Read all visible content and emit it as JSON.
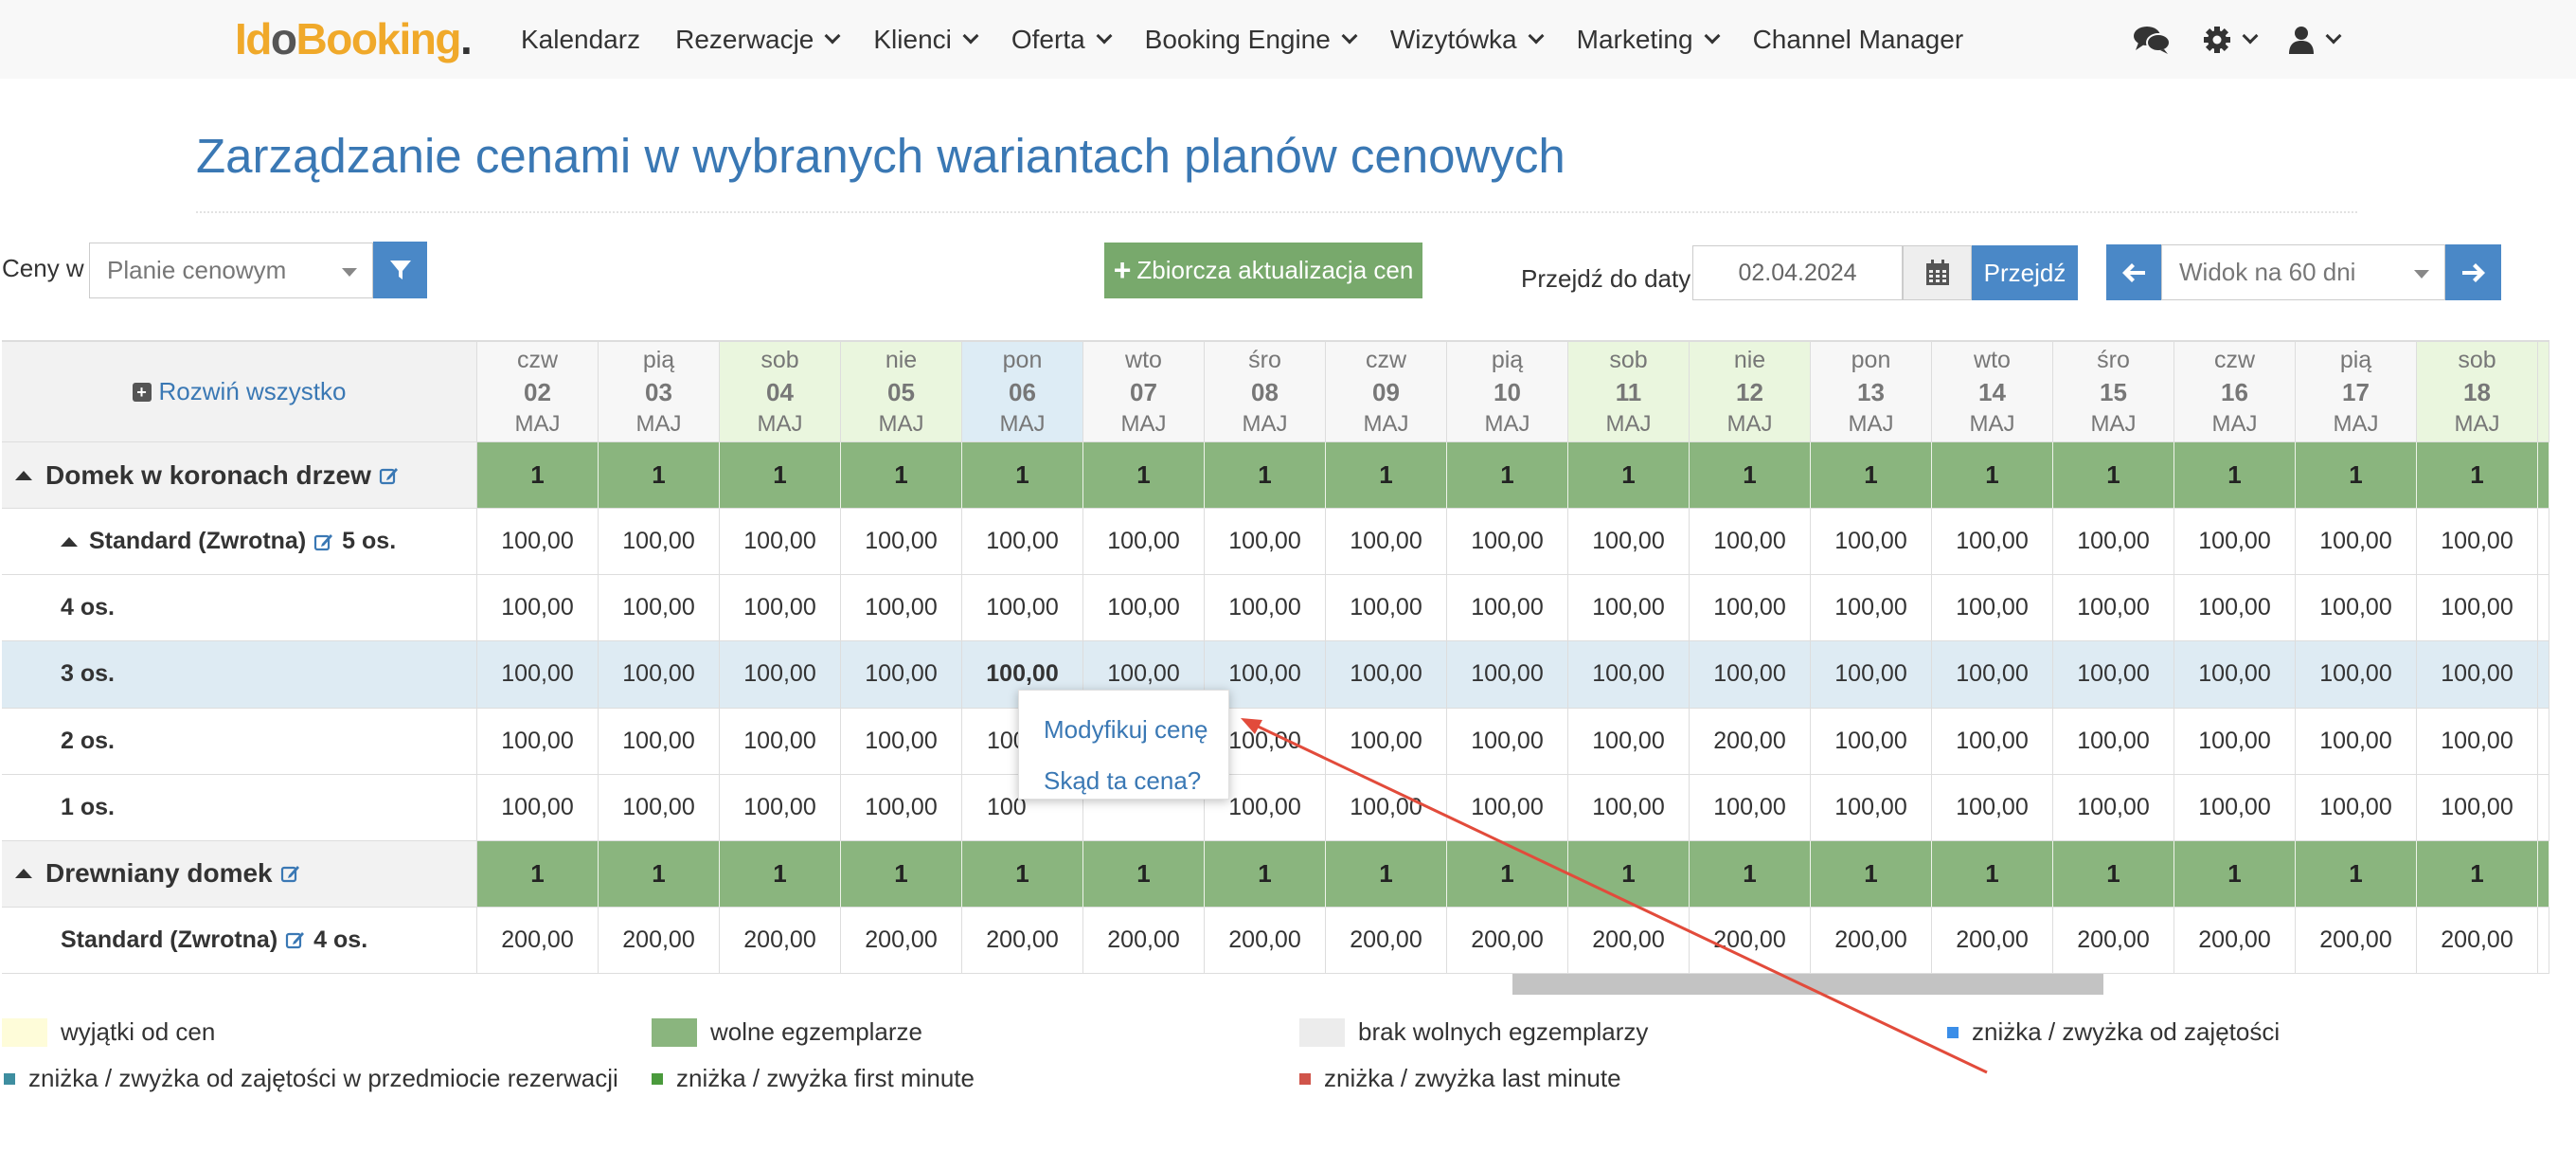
{
  "brand": {
    "part1": "Id",
    "part2": "o",
    "part3": "Booking",
    "part4": "."
  },
  "nav": {
    "items": [
      {
        "label": "Kalendarz",
        "dropdown": false
      },
      {
        "label": "Rezerwacje",
        "dropdown": true
      },
      {
        "label": "Klienci",
        "dropdown": true
      },
      {
        "label": "Oferta",
        "dropdown": true
      },
      {
        "label": "Booking Engine",
        "dropdown": true
      },
      {
        "label": "Wizytówka",
        "dropdown": true
      },
      {
        "label": "Marketing",
        "dropdown": true
      },
      {
        "label": "Channel Manager",
        "dropdown": false
      }
    ],
    "icons": [
      "chat-icon",
      "gear-icon",
      "user-icon"
    ]
  },
  "page": {
    "title": "Zarządzanie cenami w wybranych wariantach planów cenowych"
  },
  "toolbar": {
    "ceny_label": "Ceny w",
    "plan_select_value": "Planie cenowym",
    "bulk_update_label": "Zbiorcza aktualizacja cen",
    "goto_label": "Przejdź do daty",
    "date_value": "02.04.2024",
    "goto_button": "Przejdź",
    "view_select_value": "Widok na 60 dni"
  },
  "grid": {
    "expand_all": "Rozwiń wszystko",
    "columns": [
      {
        "day": "czw",
        "date": "02",
        "month": "MAJ",
        "kind": "weekday"
      },
      {
        "day": "pią",
        "date": "03",
        "month": "MAJ",
        "kind": "weekday"
      },
      {
        "day": "sob",
        "date": "04",
        "month": "MAJ",
        "kind": "weekend"
      },
      {
        "day": "nie",
        "date": "05",
        "month": "MAJ",
        "kind": "weekend"
      },
      {
        "day": "pon",
        "date": "06",
        "month": "MAJ",
        "kind": "today"
      },
      {
        "day": "wto",
        "date": "07",
        "month": "MAJ",
        "kind": "weekday"
      },
      {
        "day": "śro",
        "date": "08",
        "month": "MAJ",
        "kind": "weekday"
      },
      {
        "day": "czw",
        "date": "09",
        "month": "MAJ",
        "kind": "weekday"
      },
      {
        "day": "pią",
        "date": "10",
        "month": "MAJ",
        "kind": "weekday"
      },
      {
        "day": "sob",
        "date": "11",
        "month": "MAJ",
        "kind": "weekend"
      },
      {
        "day": "nie",
        "date": "12",
        "month": "MAJ",
        "kind": "weekend"
      },
      {
        "day": "pon",
        "date": "13",
        "month": "MAJ",
        "kind": "weekday"
      },
      {
        "day": "wto",
        "date": "14",
        "month": "MAJ",
        "kind": "weekday"
      },
      {
        "day": "śro",
        "date": "15",
        "month": "MAJ",
        "kind": "weekday"
      },
      {
        "day": "czw",
        "date": "16",
        "month": "MAJ",
        "kind": "weekday"
      },
      {
        "day": "pią",
        "date": "17",
        "month": "MAJ",
        "kind": "weekday"
      },
      {
        "day": "sob",
        "date": "18",
        "month": "MAJ",
        "kind": "weekend"
      }
    ],
    "rows": [
      {
        "type": "group",
        "label": "Domek w koronach drzew",
        "values": [
          "1",
          "1",
          "1",
          "1",
          "1",
          "1",
          "1",
          "1",
          "1",
          "1",
          "1",
          "1",
          "1",
          "1",
          "1",
          "1",
          "1"
        ]
      },
      {
        "type": "variant",
        "label": "Standard (Zwrotna)",
        "suffix": "5 os.",
        "values": [
          "100,00",
          "100,00",
          "100,00",
          "100,00",
          "100,00",
          "100,00",
          "100,00",
          "100,00",
          "100,00",
          "100,00",
          "100,00",
          "100,00",
          "100,00",
          "100,00",
          "100,00",
          "100,00",
          "100,00"
        ]
      },
      {
        "type": "occupancy",
        "label": "4 os.",
        "values": [
          "100,00",
          "100,00",
          "100,00",
          "100,00",
          "100,00",
          "100,00",
          "100,00",
          "100,00",
          "100,00",
          "100,00",
          "100,00",
          "100,00",
          "100,00",
          "100,00",
          "100,00",
          "100,00",
          "100,00"
        ]
      },
      {
        "type": "occupancy",
        "label": "3 os.",
        "highlighted": true,
        "values": [
          "100,00",
          "100,00",
          "100,00",
          "100,00",
          "100,00",
          "100,00",
          "100,00",
          "100,00",
          "100,00",
          "100,00",
          "100,00",
          "100,00",
          "100,00",
          "100,00",
          "100,00",
          "100,00",
          "100,00"
        ]
      },
      {
        "type": "occupancy",
        "label": "2 os.",
        "values": [
          "100,00",
          "100,00",
          "100,00",
          "100,00",
          "100",
          "",
          "100,00",
          "100,00",
          "100,00",
          "100,00",
          "200,00",
          "100,00",
          "100,00",
          "100,00",
          "100,00",
          "100,00",
          "100,00"
        ]
      },
      {
        "type": "occupancy",
        "label": "1 os.",
        "values": [
          "100,00",
          "100,00",
          "100,00",
          "100,00",
          "100",
          "",
          "100,00",
          "100,00",
          "100,00",
          "100,00",
          "100,00",
          "100,00",
          "100,00",
          "100,00",
          "100,00",
          "100,00",
          "100,00"
        ]
      },
      {
        "type": "group",
        "label": "Drewniany domek",
        "values": [
          "1",
          "1",
          "1",
          "1",
          "1",
          "1",
          "1",
          "1",
          "1",
          "1",
          "1",
          "1",
          "1",
          "1",
          "1",
          "1",
          "1"
        ]
      },
      {
        "type": "variant",
        "label": "Standard (Zwrotna)",
        "suffix": "4 os.",
        "values": [
          "200,00",
          "200,00",
          "200,00",
          "200,00",
          "200,00",
          "200,00",
          "200,00",
          "200,00",
          "200,00",
          "200,00",
          "200,00",
          "200,00",
          "200,00",
          "200,00",
          "200,00",
          "200,00",
          "200,00"
        ]
      }
    ]
  },
  "context_menu": {
    "modify": "Modyfikuj cenę",
    "source": "Skąd ta cena?"
  },
  "legend": [
    {
      "label": "wyjątki od cen",
      "color": "#fefcd9",
      "kind": "box"
    },
    {
      "label": "wolne egzemplarze",
      "color": "#8ab57e",
      "kind": "box"
    },
    {
      "label": "brak wolnych egzemplarzy",
      "color": "#ececec",
      "kind": "box"
    },
    {
      "label": "zniżka / zwyżka od zajętości",
      "color": "#3b8ee8",
      "kind": "dot"
    },
    {
      "label": "zniżka / zwyżka od zajętości w przedmiocie rezerwacji",
      "color": "#3e8ea0",
      "kind": "dot"
    },
    {
      "label": "zniżka / zwyżka first minute",
      "color": "#4a9a3c",
      "kind": "dot"
    },
    {
      "label": "zniżka / zwyżka last minute",
      "color": "#d0544a",
      "kind": "dot"
    }
  ],
  "colors": {
    "accent": "#3a78b4",
    "button": "#4a88c7",
    "bulk_button": "#78a96c",
    "weekend": "#eaf6de",
    "today": "#ddecf5",
    "available": "#8ab57e",
    "annotation": "#e24b3b"
  }
}
